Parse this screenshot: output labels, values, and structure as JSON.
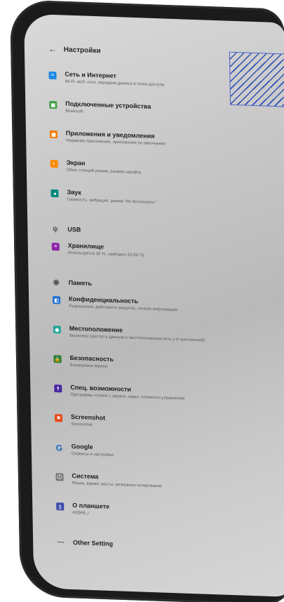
{
  "header": {
    "title": "Настройки",
    "back": "←"
  },
  "items": [
    {
      "title": "Сеть и Интернет",
      "subtitle": "Wi-Fi, моб. сети, передача данных и точка доступа",
      "icon": "wifi-icon",
      "color": "#1e88e5",
      "glyph": "≈"
    },
    {
      "title": "Подключенные устройства",
      "subtitle": "Bluetooth",
      "icon": "devices-icon",
      "color": "#43a047",
      "glyph": "▣"
    },
    {
      "title": "Приложения и уведомления",
      "subtitle": "Недавние приложения, приложения по умолчанию",
      "icon": "apps-icon",
      "color": "#f57c00",
      "glyph": "▦"
    },
    {
      "title": "Экран",
      "subtitle": "Обои, спящий режим, размер шрифта",
      "icon": "display-icon",
      "color": "#fb8c00",
      "glyph": "◐"
    },
    {
      "title": "Звук",
      "subtitle": "Громкость, вибрация, режим \"Не беспокоить\"",
      "icon": "sound-icon",
      "color": "#00897b",
      "glyph": "◂"
    },
    {
      "title": "USB",
      "subtitle": "",
      "icon": "usb-icon",
      "color": "transparent",
      "glyph": "ψ"
    },
    {
      "title": "Хранилище",
      "subtitle": "Используется 36 %, свободно 20,59 ГБ",
      "icon": "storage-icon",
      "color": "#8e24aa",
      "glyph": "≡"
    },
    {
      "title": "Память",
      "subtitle": "",
      "icon": "memory-icon",
      "color": "transparent",
      "glyph": "◉"
    },
    {
      "title": "Конфиденциальность",
      "subtitle": "Разрешения, действия в аккаунте, личная информация",
      "icon": "privacy-icon",
      "color": "#1e6fd0",
      "glyph": "◧"
    },
    {
      "title": "Местоположение",
      "subtitle": "Включено (доступ к данным о местоположении есть у 9 приложений)",
      "icon": "location-icon",
      "color": "#26a69a",
      "glyph": "◉"
    },
    {
      "title": "Безопасность",
      "subtitle": "Блокировка экрана",
      "icon": "lock-icon",
      "color": "#2e7d32",
      "glyph": "🔒"
    },
    {
      "title": "Спец. возможности",
      "subtitle": "Программы чтения с экрана, экран, элементы управления",
      "icon": "accessibility-icon",
      "color": "#4527a0",
      "glyph": "☨"
    },
    {
      "title": "Screenshot",
      "subtitle": "Screenshot",
      "icon": "screenshot-icon",
      "color": "#e64a19",
      "glyph": "◙"
    },
    {
      "title": "Google",
      "subtitle": "Сервисы и настройки",
      "icon": "google-icon",
      "color": "transparent",
      "glyph": "G"
    },
    {
      "title": "Система",
      "subtitle": "Языки, время, жесты, резервное копирование",
      "icon": "system-icon",
      "color": "#757575",
      "glyph": "ⓘ"
    },
    {
      "title": "О планшете",
      "subtitle": "rk3568_r",
      "icon": "tablet-icon",
      "color": "#3949ab",
      "glyph": "▯"
    },
    {
      "title": "Other Setting",
      "subtitle": "",
      "icon": "other-setting-icon",
      "color": "transparent",
      "glyph": "—"
    }
  ]
}
